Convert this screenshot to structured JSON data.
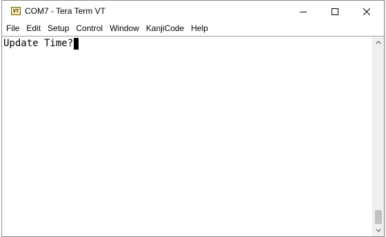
{
  "window": {
    "title": "COM7 - Tera Term VT",
    "app_icon_text": "VT",
    "controls": {
      "minimize": "minimize-icon",
      "maximize": "maximize-icon",
      "close": "close-icon"
    }
  },
  "menu": {
    "items": [
      {
        "label": "File"
      },
      {
        "label": "Edit"
      },
      {
        "label": "Setup"
      },
      {
        "label": "Control"
      },
      {
        "label": "Window"
      },
      {
        "label": "KanjiCode"
      },
      {
        "label": "Help"
      }
    ]
  },
  "terminal": {
    "lines": [
      "Update Time?"
    ],
    "background": "#ffffff",
    "foreground": "#000000"
  },
  "scrollbar": {
    "position": 1.0
  }
}
